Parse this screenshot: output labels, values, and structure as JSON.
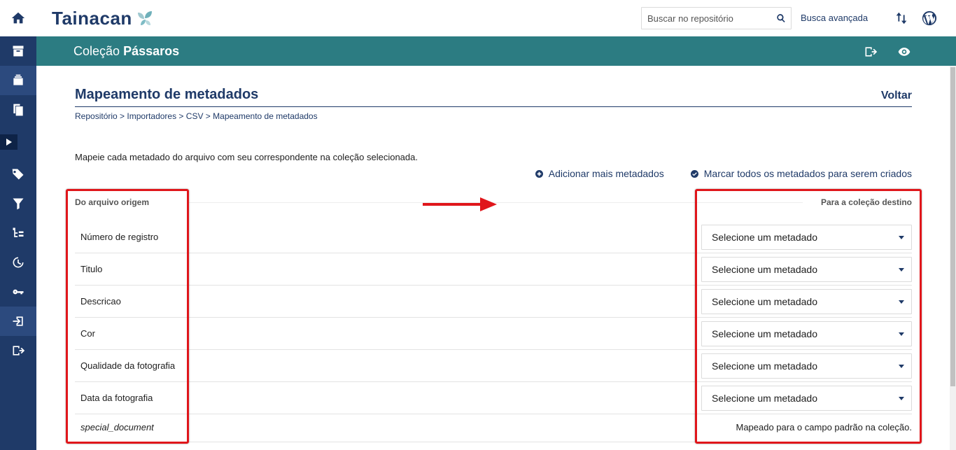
{
  "brand": {
    "logo_text": "Tainacan",
    "accent": "#1f3a68",
    "teal": "#2c7c82",
    "annotation_red": "#e0161b"
  },
  "sidebar": {
    "items": [
      {
        "name": "home",
        "icon": "home-icon"
      },
      {
        "name": "collections",
        "icon": "archive-icon"
      },
      {
        "name": "items",
        "icon": "items-icon"
      },
      {
        "name": "pages",
        "icon": "copies-icon"
      },
      {
        "name": "taxonomies",
        "icon": "tags-icon"
      },
      {
        "name": "filters",
        "icon": "filter-icon"
      },
      {
        "name": "metadata",
        "icon": "hierarchy-icon"
      },
      {
        "name": "activities",
        "icon": "history-icon"
      },
      {
        "name": "capabilities",
        "icon": "key-icon"
      },
      {
        "name": "importers",
        "icon": "import-icon"
      },
      {
        "name": "exporters",
        "icon": "export-icon"
      }
    ],
    "expand_icon": "chevron-right-icon"
  },
  "header": {
    "search_placeholder": "Buscar no repositório",
    "advanced_search": "Busca avançada"
  },
  "collection_bar": {
    "prefix": "Coleção",
    "name": "Pássaros"
  },
  "page": {
    "title": "Mapeamento de metadados",
    "back": "Voltar",
    "breadcrumb": [
      "Repositório",
      "Importadores",
      "CSV",
      "Mapeamento de metadados"
    ],
    "breadcrumb_separator": " > ",
    "intro": "Mapeie cada metadado do arquivo com seu correspondente na coleção selecionada.",
    "add_more": "Adicionar mais metadados",
    "mark_all": "Marcar todos os metadados para serem criados",
    "source_header": "Do arquivo origem",
    "target_header": "Para a coleção destino"
  },
  "mapping": {
    "rows": [
      {
        "source": "Número de registro",
        "target": "Selecione um metadado"
      },
      {
        "source": "Titulo",
        "target": "Selecione um metadado"
      },
      {
        "source": "Descricao",
        "target": "Selecione um metadado"
      },
      {
        "source": "Cor",
        "target": "Selecione um metadado"
      },
      {
        "source": "Qualidade da fotografia",
        "target": "Selecione um metadado"
      },
      {
        "source": "Data da fotografia",
        "target": "Selecione um metadado"
      }
    ],
    "special": {
      "source": "special_document",
      "note": "Mapeado para o campo padrão na coleção."
    }
  }
}
